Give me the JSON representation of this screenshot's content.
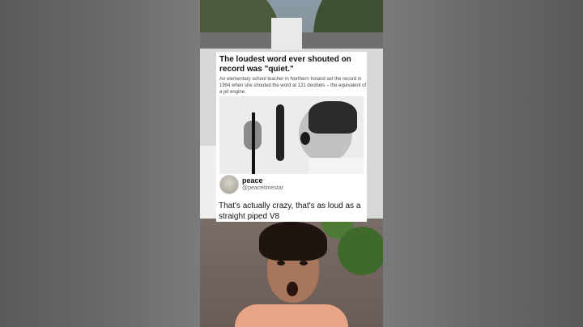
{
  "post": {
    "headline": "The loudest word ever shouted on record was \"quiet.\"",
    "subtext": "An elementary school teacher in Northern Ireland set the record in 1994 when she shouted the word at 121 decibels – the equivalent of a jet engine."
  },
  "reply": {
    "name": "peace",
    "handle": "@peacetimestar",
    "text": "That's actually crazy, that's as loud as a straight piped V8"
  },
  "colors": {
    "card_bg": "#ffffff",
    "shirt": "#e8a487",
    "background_blur": "#5e5e5e"
  }
}
